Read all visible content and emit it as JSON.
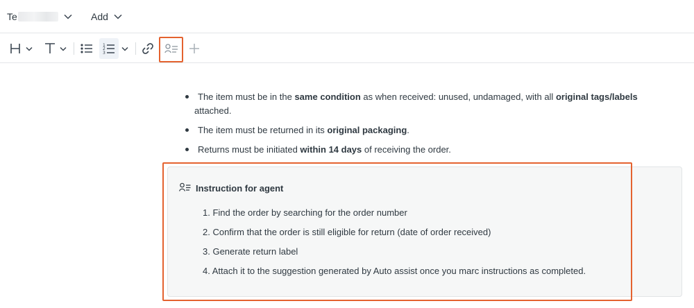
{
  "menubar": {
    "first_label": "Te",
    "add_label": "Add"
  },
  "toolbar": {
    "heading_icon": "heading-icon",
    "text_icon": "text-style-icon",
    "bullet_list_icon": "bullet-list-icon",
    "numbered_list_icon": "numbered-list-icon",
    "link_icon": "link-icon",
    "agent_instruction_icon": "agent-instruction-icon",
    "add_icon": "plus-icon"
  },
  "content": {
    "bullets": [
      {
        "p1": "The item must be in the ",
        "b1": "same condition",
        "p2": " as when received: unused, undamaged, with all ",
        "b2": "original tags/labels",
        "p3": " attached."
      },
      {
        "p1": "The item must be returned in its ",
        "b1": "original packaging",
        "p2": "."
      },
      {
        "p1": "Returns must be initiated ",
        "b1": "within 14 days",
        "p2": " of receiving the order."
      }
    ],
    "agent_box": {
      "title": "Instruction for agent",
      "steps": [
        "1. Find the order by searching for the order number",
        "2. Confirm that the order is still eligible for return (date of order received)",
        "3.  Generate return label",
        "4. Attach it to the suggestion generated by Auto assist once you marc instructions as completed."
      ]
    }
  },
  "colors": {
    "highlight": "#e4622f",
    "text": "#2f3941",
    "box_bg": "#f6f7f7"
  }
}
